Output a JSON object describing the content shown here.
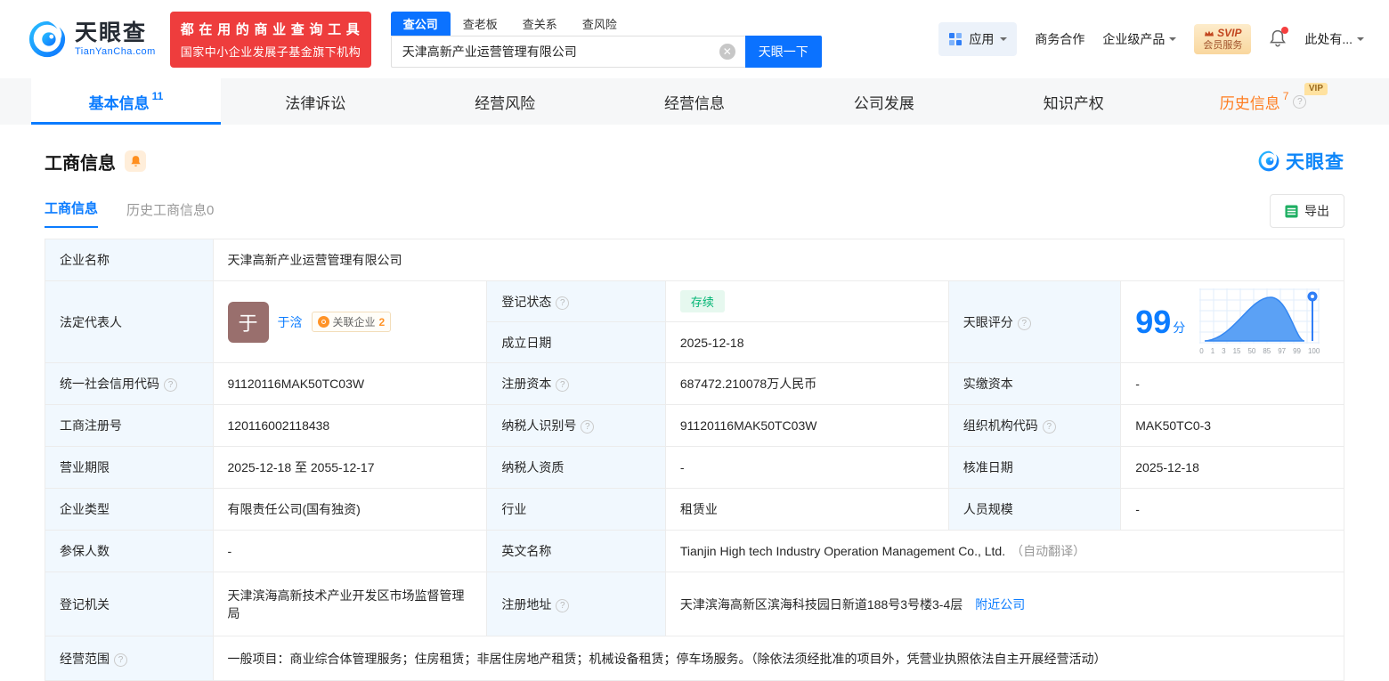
{
  "colors": {
    "brand_blue": "#0b72ff",
    "accent_blue": "#0b7cff",
    "red": "#ee3d3d",
    "orange": "#ff7d20",
    "green": "#00b473",
    "label_bg": "#f1f8fe",
    "gold": "#ffe2a0"
  },
  "header": {
    "logo": {
      "cn": "天眼查",
      "domain": "TianYanCha.com"
    },
    "slogan": {
      "line1": "都在用的商业查询工具",
      "line2": "国家中小企业发展子基金旗下机构"
    },
    "search": {
      "tabs": [
        "查公司",
        "查老板",
        "查关系",
        "查风险"
      ],
      "value": "天津高新产业运营管理有限公司",
      "button": "天眼一下"
    },
    "menu": {
      "apps": "应用",
      "cooperation": "商务合作",
      "enterprise_products": "企业级产品",
      "svip_top": "SVIP",
      "svip_bottom": "会员服务",
      "user": "此处有..."
    }
  },
  "nav": {
    "tabs": [
      {
        "label": "基本信息",
        "count": "11"
      },
      {
        "label": "法律诉讼"
      },
      {
        "label": "经营风险"
      },
      {
        "label": "经营信息"
      },
      {
        "label": "公司发展"
      },
      {
        "label": "知识产权"
      },
      {
        "label": "历史信息",
        "count": "7",
        "vip": "VIP"
      }
    ]
  },
  "section": {
    "title": "工商信息",
    "watermark": "天眼查",
    "sub_tabs": {
      "current": "工商信息",
      "history": "历史工商信息",
      "history_count": "0"
    },
    "export": "导出"
  },
  "table": {
    "labels": {
      "name": "企业名称",
      "legal_rep": "法定代表人",
      "reg_status": "登记状态",
      "establish_date": "成立日期",
      "score": "天眼评分",
      "credit_code": "统一社会信用代码",
      "reg_capital": "注册资本",
      "paid_capital": "实缴资本",
      "reg_number": "工商注册号",
      "taxpayer_id": "纳税人识别号",
      "org_code": "组织机构代码",
      "business_term": "营业期限",
      "taxpayer_quality": "纳税人资质",
      "approval_date": "核准日期",
      "company_type": "企业类型",
      "industry": "行业",
      "staff_size": "人员规模",
      "insured_count": "参保人数",
      "english_name": "英文名称",
      "reg_authority": "登记机关",
      "reg_address": "注册地址",
      "business_scope": "经营范围"
    },
    "values": {
      "name": "天津高新产业运营管理有限公司",
      "legal_rep_avatar": "于",
      "legal_rep_name": "于浛",
      "related_label": "关联企业",
      "related_count": "2",
      "reg_status": "存续",
      "establish_date": "2025-12-18",
      "score": "99",
      "score_unit": "分",
      "score_axis": [
        "0",
        "1",
        "3",
        "15",
        "50",
        "85",
        "97",
        "99",
        "100"
      ],
      "credit_code": "91120116MAK50TC03W",
      "reg_capital": "687472.210078万人民币",
      "paid_capital": "-",
      "reg_number": "120116002118438",
      "taxpayer_id": "91120116MAK50TC03W",
      "org_code": "MAK50TC0-3",
      "business_term": "2025-12-18 至 2055-12-17",
      "taxpayer_quality": "-",
      "approval_date": "2025-12-18",
      "company_type": "有限责任公司(国有独资)",
      "industry": "租赁业",
      "staff_size": "-",
      "insured_count": "-",
      "english_name": "Tianjin High tech Industry Operation Management Co., Ltd.",
      "english_name_note": "（自动翻译）",
      "reg_authority": "天津滨海高新技术产业开发区市场监督管理局",
      "reg_address": "天津滨海高新区滨海科技园日新道188号3号楼3-4层",
      "nearby_link": "附近公司",
      "business_scope": "一般项目：商业综合体管理服务；住房租赁；非居住房地产租赁；机械设备租赁；停车场服务。（除依法须经批准的项目外，凭营业执照依法自主开展经营活动）"
    }
  }
}
